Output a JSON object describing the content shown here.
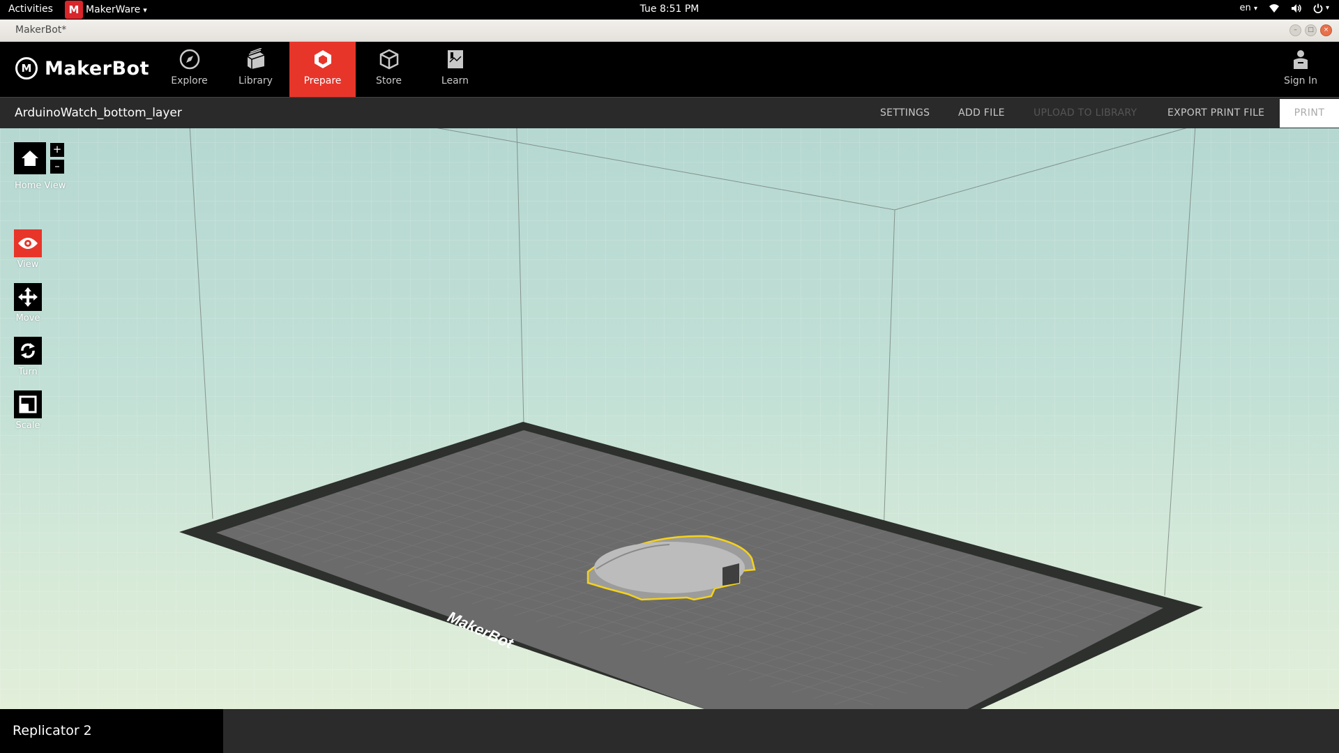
{
  "system_bar": {
    "activities": "Activities",
    "app_menu": "MakerWare",
    "app_menu_arrow": "▾",
    "clock": "Tue  8:51 PM",
    "language": "en",
    "language_arrow": "▾",
    "icons": [
      "wifi-icon",
      "volume-icon",
      "power-icon"
    ]
  },
  "window": {
    "title": "MakerBot*",
    "controls": [
      "minimize",
      "maximize",
      "close"
    ]
  },
  "header": {
    "brand": "MakerBot",
    "nav": [
      {
        "label": "Explore",
        "icon": "compass-icon",
        "active": false
      },
      {
        "label": "Library",
        "icon": "library-icon",
        "active": false
      },
      {
        "label": "Prepare",
        "icon": "prepare-icon",
        "active": true
      },
      {
        "label": "Store",
        "icon": "box-icon",
        "active": false
      },
      {
        "label": "Learn",
        "icon": "book-icon",
        "active": false
      }
    ],
    "sign_in": "Sign In"
  },
  "action_bar": {
    "filename": "ArduinoWatch_bottom_layer",
    "settings": "SETTINGS",
    "add_file": "ADD FILE",
    "upload": "UPLOAD TO LIBRARY",
    "export": "EXPORT PRINT FILE",
    "print": "PRINT"
  },
  "tools": {
    "home_view": "Home View",
    "zoom_in": "+",
    "zoom_out": "–",
    "view": "View",
    "move": "Move",
    "turn": "Turn",
    "scale": "Scale"
  },
  "build_plate": {
    "brand_text": "MakerBot"
  },
  "colors": {
    "accent": "#e8352a",
    "selection": "#f5d21a"
  },
  "bottom_bar": {
    "printer": "Replicator 2"
  }
}
